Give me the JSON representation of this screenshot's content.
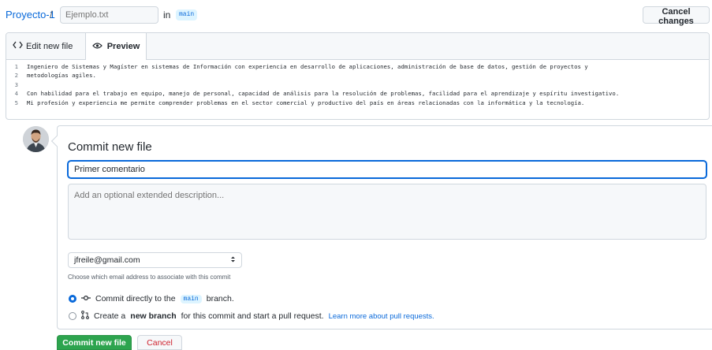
{
  "header": {
    "repo": "Proyecto-1",
    "separator": "/",
    "filename_placeholder": "Ejemplo.txt",
    "in_text": "in",
    "branch": "main",
    "cancel_changes": "Cancel changes"
  },
  "editor": {
    "tabs": {
      "edit": "Edit new file",
      "preview": "Preview"
    },
    "lines": [
      {
        "n": "1",
        "text": "Ingeniero de Sistemas y Magíster en sistemas de Información con experiencia en desarrollo de aplicaciones, administración de base de datos, gestión de proyectos y"
      },
      {
        "n": "2",
        "text": "metodologías agiles."
      },
      {
        "n": "3",
        "text": ""
      },
      {
        "n": "4",
        "text": "Con habilidad para el trabajo en equipo, manejo de personal, capacidad de análisis para la resolución de problemas, facilidad para el aprendizaje y espíritu investigativo."
      },
      {
        "n": "5",
        "text": "Mi profesión y experiencia me permite comprender problemas en el sector comercial y productivo del país en áreas relacionadas con la informática y la tecnología."
      }
    ]
  },
  "commit": {
    "title": "Commit new file",
    "summary_value": "Primer comentario",
    "description_placeholder": "Add an optional extended description...",
    "email": "jfreile@gmail.com",
    "email_hint": "Choose which email address to associate with this commit",
    "option1": {
      "before": "Commit directly to the",
      "branch": "main",
      "after": "branch."
    },
    "option2": {
      "before": "Create a",
      "bold": "new branch",
      "after": "for this commit and start a pull request.",
      "link": "Learn more about pull requests."
    },
    "commit_button": "Commit new file",
    "cancel_button": "Cancel"
  },
  "colors": {
    "accent": "#0969da",
    "commit_green": "#2da44e",
    "cancel_red": "#cf222e"
  },
  "icons": [
    "code-icon",
    "eye-icon",
    "git-commit-icon",
    "git-pull-request-icon",
    "select-arrows-icon"
  ]
}
